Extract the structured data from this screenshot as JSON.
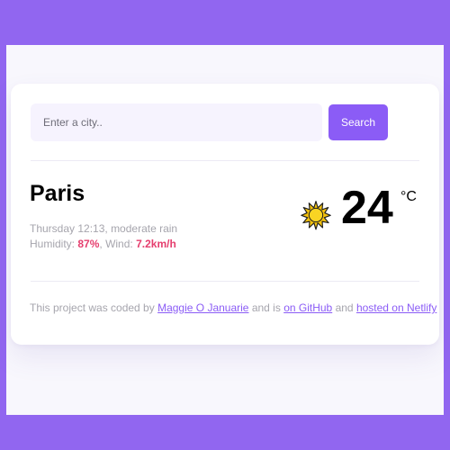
{
  "colors": {
    "frame": "#9166f0",
    "page_background": "#f8f7fd",
    "accent": "#8b5cf6",
    "highlight": "#e53e6e",
    "muted_text": "#a6a5ad"
  },
  "search": {
    "placeholder": "Enter a city..",
    "button_label": "Search"
  },
  "weather": {
    "city": "Paris",
    "day_time": "Thursday 12:13",
    "description": "moderate rain",
    "humidity_label": "Humidity:",
    "humidity_value": "87%",
    "wind_label": "Wind:",
    "wind_value": "7.2km/h",
    "icon": "sun-icon",
    "temperature": "24",
    "unit": "°C"
  },
  "footer": {
    "text_1": "This project was coded by",
    "author_link": "Maggie O Januarie",
    "text_2": "and is",
    "github_link": "on GitHub",
    "text_3": "and",
    "netlify_link": "hosted on Netlify"
  }
}
